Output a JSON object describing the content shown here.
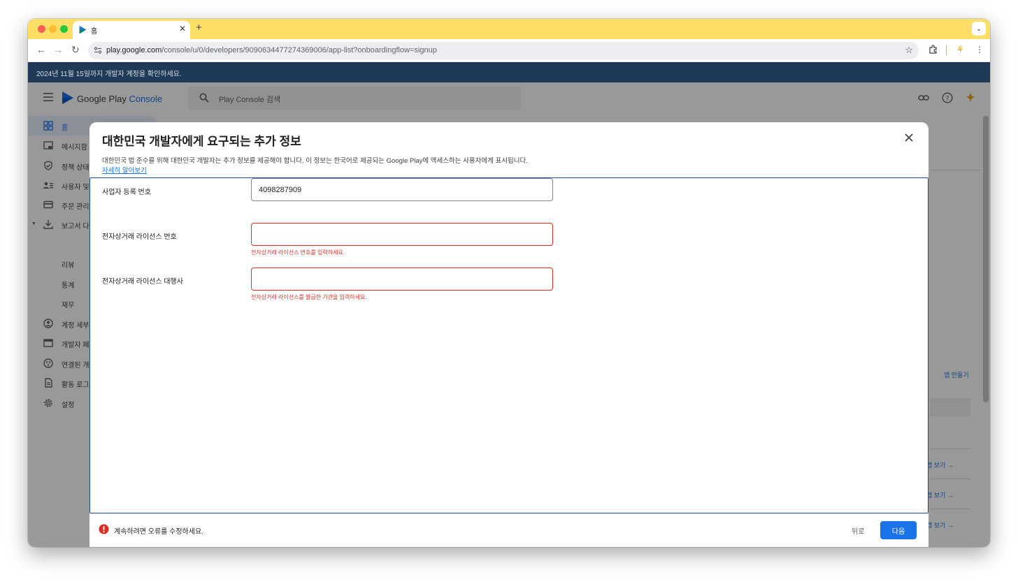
{
  "browser": {
    "tab_title": "홈",
    "new_tab": "+",
    "url_host": "play.google.com",
    "url_path": "/console/u/0/developers/9090634477274369006/app-list?onboardingflow=signup"
  },
  "banner": {
    "text": "2024년 11월 15일까지 개발자 계정을 확인하세요."
  },
  "app": {
    "logo_text": "Google Play",
    "logo_accent": "Console",
    "search_placeholder": "Play Console 검색",
    "sidebar": {
      "items": [
        {
          "label": "홈",
          "icon": "grid-icon"
        },
        {
          "label": "메시지함",
          "icon": "inbox-icon"
        },
        {
          "label": "정책 상태",
          "icon": "shield-icon"
        },
        {
          "label": "사용자 및",
          "icon": "users-icon"
        },
        {
          "label": "주문 관리",
          "icon": "card-icon"
        },
        {
          "label": "보고서 다",
          "icon": "download-icon"
        },
        {
          "label": "계정 세부",
          "icon": "account-icon"
        },
        {
          "label": "개발자 페",
          "icon": "page-icon"
        },
        {
          "label": "연결된 개",
          "icon": "link-icon"
        },
        {
          "label": "활동 로그",
          "icon": "log-icon"
        },
        {
          "label": "설정",
          "icon": "gear-icon"
        }
      ],
      "sub_items": [
        "리뷰",
        "통계",
        "재무"
      ]
    },
    "right": {
      "create_app": "앱 만들기",
      "view_app": "앱 보기 →"
    }
  },
  "modal": {
    "title": "대한민국 개발자에게 요구되는 추가 정보",
    "description": "대한민국 법 준수를 위해 대한민국 개발자는 추가 정보를 제공해야 합니다. 이 정보는 한국어로 제공되는 Google Play에 액세스하는 사용자에게 표시됩니다.",
    "learn_more": "자세히 알아보기",
    "fields": [
      {
        "label": "사업자 등록 번호",
        "value": "4098287909",
        "error": ""
      },
      {
        "label": "전자상거래 라이선스 번호",
        "value": "",
        "error": "전자상거래 라이선스 번호를 입력하세요."
      },
      {
        "label": "전자상거래 라이선스 대행사",
        "value": "",
        "error": "전자상거래 라이선스를 발급한 기관을 입력하세요."
      }
    ],
    "footer_message": "계속하려면 오류를 수정하세요.",
    "back_label": "뒤로",
    "next_label": "다음"
  },
  "colors": {
    "tabbar": "#fddf66",
    "banner": "#1f3a57",
    "accent": "#1a73e8",
    "error": "#d93025"
  }
}
